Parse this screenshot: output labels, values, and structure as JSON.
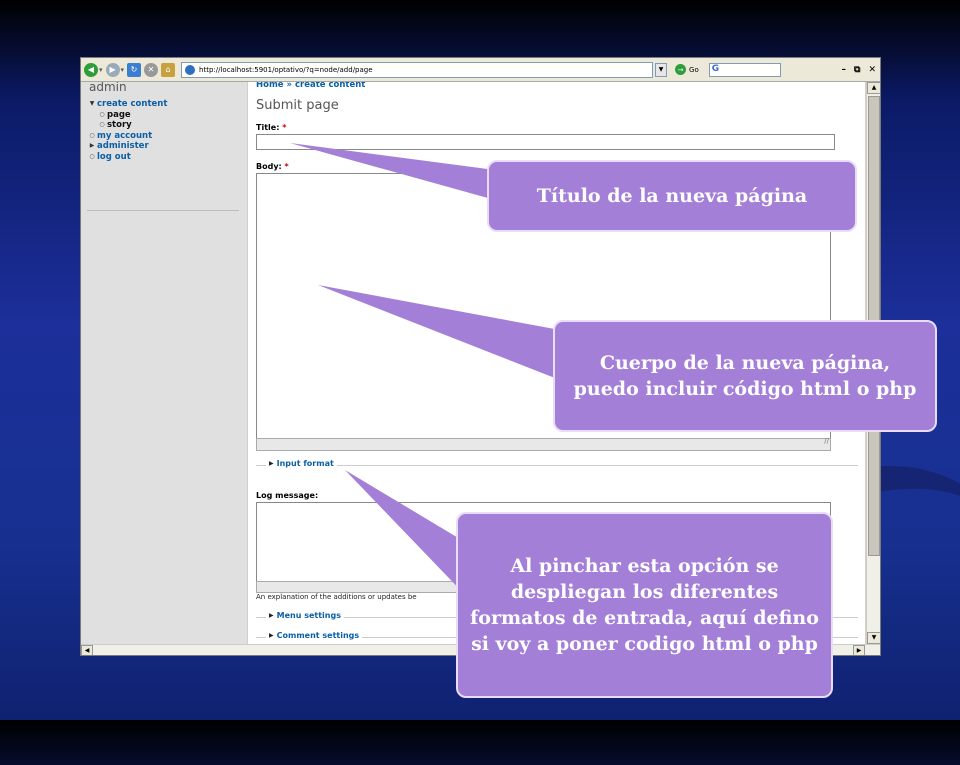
{
  "browser": {
    "address_url": "http://localhost:5901/optativo/?q=node/add/page",
    "go_label": "Go",
    "google_letter": "G"
  },
  "sidebar": {
    "user": "admin",
    "items": [
      {
        "label": "create content",
        "marker": "expanded"
      },
      {
        "label": "page",
        "marker": "bullet",
        "sub": true
      },
      {
        "label": "story",
        "marker": "bullet",
        "sub": true
      },
      {
        "label": "my account",
        "marker": "bullet"
      },
      {
        "label": "administer",
        "marker": "collapsed"
      },
      {
        "label": "log out",
        "marker": "bullet"
      }
    ]
  },
  "main": {
    "breadcrumb": "Home » create content",
    "page_title": "Submit page",
    "title_label": "Title:",
    "body_label": "Body:",
    "required_mark": "*",
    "input_format": "Input format",
    "log_label": "Log message:",
    "log_description": "An explanation of the additions or updates be",
    "menu_settings": "Menu settings",
    "comment_settings": "Comment settings"
  },
  "callouts": {
    "title": "Título de la nueva página",
    "body": "Cuerpo de la nueva página, puedo incluir código html o php",
    "format": "Al pinchar esta opción se despliegan los diferentes formatos de entrada,  aquí defino si voy a poner codigo html o php"
  },
  "colors": {
    "callout": "#a47fd8",
    "background": "#1c2f9a",
    "link": "#0b5fa5"
  }
}
